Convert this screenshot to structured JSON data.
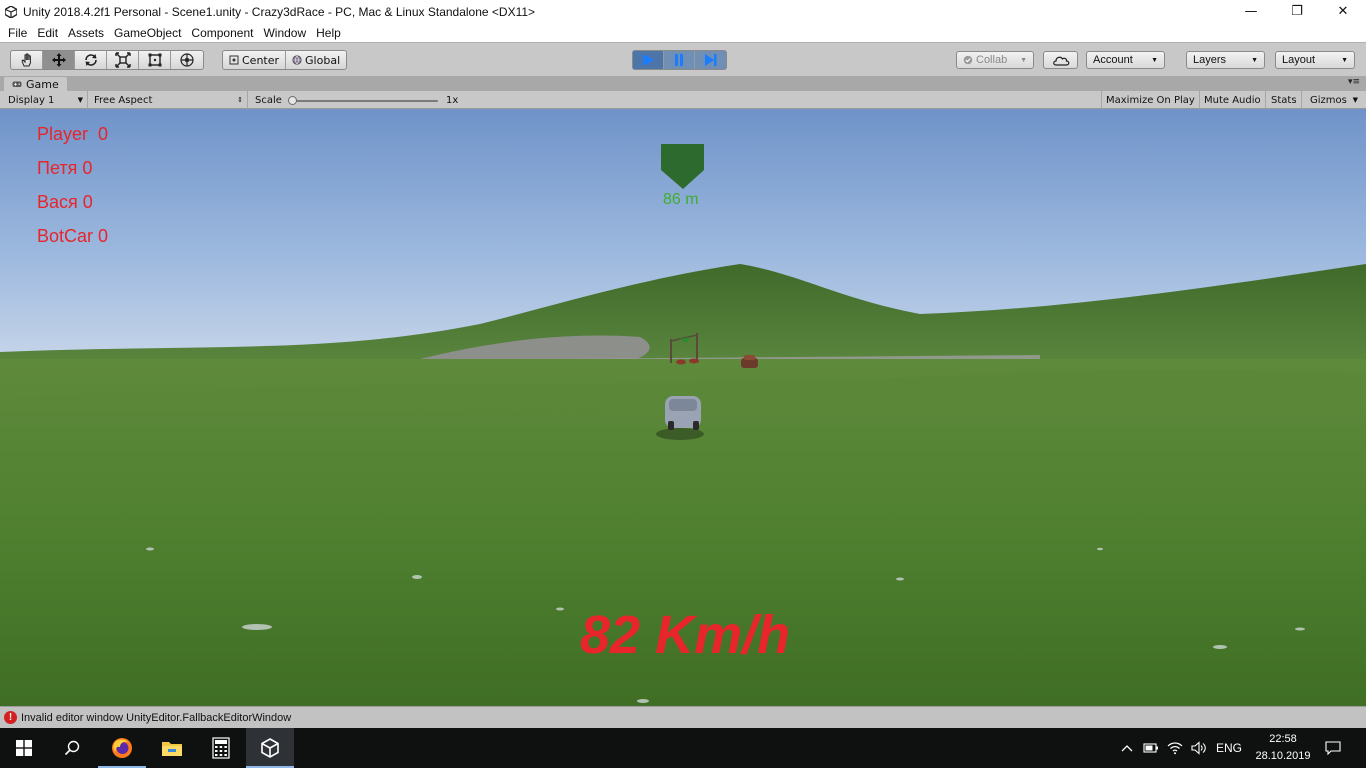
{
  "window": {
    "title": "Unity 2018.4.2f1 Personal - Scene1.unity - Crazy3dRace - PC, Mac & Linux Standalone <DX11>",
    "minimize_glyph": "—",
    "maximize_glyph": "❐",
    "close_glyph": "✕"
  },
  "menu": [
    "File",
    "Edit",
    "Assets",
    "GameObject",
    "Component",
    "Window",
    "Help"
  ],
  "toolbar": {
    "tools": [
      "hand-tool-icon",
      "move-tool-icon",
      "rotate-tool-icon",
      "scale-tool-icon",
      "rect-tool-icon",
      "transform-tool-icon"
    ],
    "pivot_label": "Center",
    "space_label": "Global",
    "collab_label": "Collab",
    "account_label": "Account",
    "layers_label": "Layers",
    "layout_label": "Layout"
  },
  "game_panel": {
    "tab_label": "Game",
    "display_label": "Display 1",
    "aspect_label": "Free Aspect",
    "scale_label": "Scale",
    "scale_value": "1x",
    "maximize_label": "Maximize On Play",
    "mute_label": "Mute Audio",
    "stats_label": "Stats",
    "gizmos_label": "Gizmos"
  },
  "hud": {
    "scores": [
      "Player  0",
      "Петя 0",
      "Вася 0",
      "BotCar 0"
    ],
    "distance": "86 m",
    "speed": "82 Km/h"
  },
  "status": {
    "message": "Invalid editor window UnityEditor.FallbackEditorWindow"
  },
  "taskbar": {
    "language": "ENG",
    "time": "22:58",
    "date": "28.10.2019"
  },
  "colors": {
    "hud_text": "#e8252b",
    "distance_text": "#3fae2e",
    "play_active": "#4e75a8"
  }
}
